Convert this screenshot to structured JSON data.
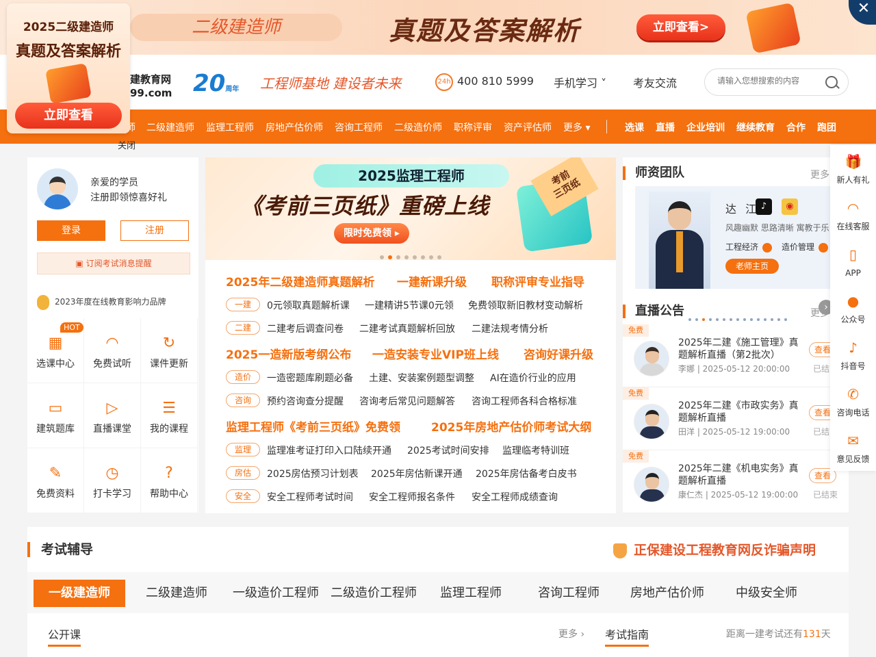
{
  "banner": {
    "pill": "二级建造师",
    "headline": "真题及答案解析",
    "cta": "立即查看>",
    "close": "✕"
  },
  "promo": {
    "line1": "2025二级建造师",
    "line2": "真题及答案解析",
    "button": "立即查看",
    "close": "关闭"
  },
  "header": {
    "logo_line1": "建教育网",
    "logo_line2": "99.com",
    "anniversary": "20",
    "anniversary_sub": "周年",
    "slogan": "工程师基地  建设者未来",
    "phone": "400 810 5999",
    "phone_icon": "24h",
    "nav": [
      "手机学习 ˅",
      "考友交流"
    ],
    "search_placeholder": "请输入您想搜索的内容"
  },
  "orange_nav": {
    "items": [
      "师",
      "二级建造师",
      "监理工程师",
      "房地产估价师",
      "咨询工程师",
      "二级造价师",
      "职称评审",
      "资产评估师",
      "更多 ▾"
    ],
    "bold_items": [
      "选课",
      "直播",
      "企业培训",
      "继续教育",
      "合作",
      "跑团"
    ]
  },
  "left": {
    "greeting1": "亲爱的学员",
    "greeting2": "注册即领惊喜好礼",
    "login": "登录",
    "register": "注册",
    "subscribe": "订阅考试消息提醒",
    "brand": "2023年度在线教育影响力品牌",
    "hot": "HOT",
    "grid": [
      {
        "label": "选课中心",
        "icon": "calendar-icon",
        "glyph": "▦"
      },
      {
        "label": "免费试听",
        "icon": "headphones-icon",
        "glyph": "◠"
      },
      {
        "label": "课件更新",
        "icon": "refresh-icon",
        "glyph": "↻"
      },
      {
        "label": "建筑题库",
        "icon": "monitor-icon",
        "glyph": "▭"
      },
      {
        "label": "直播课堂",
        "icon": "play-icon",
        "glyph": "▷"
      },
      {
        "label": "我的课程",
        "icon": "board-icon",
        "glyph": "☰"
      },
      {
        "label": "免费资料",
        "icon": "document-icon",
        "glyph": "✎"
      },
      {
        "label": "打卡学习",
        "icon": "alarm-icon",
        "glyph": "◷"
      },
      {
        "label": "帮助中心",
        "icon": "help-icon",
        "glyph": "?"
      }
    ]
  },
  "hero": {
    "tag": "2025监理工程师",
    "title": "《考前三页纸》重磅上线",
    "free": "限时免费领 ▸",
    "corner": "考前\n三页纸"
  },
  "news": {
    "h1": [
      "2025年二级建造师真题解析",
      "一建新课升级",
      "职称评审专业指导"
    ],
    "row1": {
      "tag": "一建",
      "links": [
        "0元领取真题解析课",
        "一建精讲5节课0元领",
        "免费领取新旧教材变动解析"
      ]
    },
    "row2": {
      "tag": "二建",
      "links": [
        "二建考后调查问卷",
        "二建考试真题解析回放",
        "二建法规考情分析"
      ]
    },
    "h2": [
      "2025一造新版考纲公布",
      "一造安装专业VIP班上线",
      "咨询好课升级"
    ],
    "row3": {
      "tag": "造价",
      "links": [
        "一造密题库刷题必备",
        "土建、安装案例题型调整",
        "AI在造价行业的应用"
      ]
    },
    "row4": {
      "tag": "咨询",
      "links": [
        "预约咨询查分提醒",
        "咨询考后常见问题解答",
        "咨询工程师各科合格标准"
      ]
    },
    "h3": [
      "监理工程师《考前三页纸》免费领",
      "2025年房地产估价师考试大纲"
    ],
    "row5": {
      "tag": "监理",
      "links": [
        "监理准考证打印入口陆续开通",
        "2025考试时间安排",
        "监理临考特训班"
      ]
    },
    "row6": {
      "tag": "房估",
      "links": [
        "2025房估预习计划表",
        "2025年房估新课开通",
        "2025年房估备考白皮书"
      ]
    },
    "row7": {
      "tag": "安全",
      "links": [
        "安全工程师考试时间",
        "安全工程师报名条件",
        "安全工程师成绩查询"
      ]
    }
  },
  "teachers": {
    "title": "师资团队",
    "more": "更多",
    "name": "达 江",
    "desc": "风趣幽默 思路清晰 寓教于乐",
    "subject1": "工程经济",
    "subject2": "造价管理",
    "home": "老师主页",
    "tiktok": "♪",
    "weibo": "◉"
  },
  "live": {
    "title": "直播公告",
    "more": "更多",
    "items": [
      {
        "tag": "免费",
        "title": "2025年二建《施工管理》真题解析直播（第2批次）",
        "meta": "李娜 | 2025-05-12 20:00:00",
        "btn": "查看",
        "status": "已结束"
      },
      {
        "tag": "免费",
        "title": "2025年二建《市政实务》真题解析直播",
        "meta": "田洋 | 2025-05-12 19:00:00",
        "btn": "查看",
        "status": "已结束"
      },
      {
        "tag": "免费",
        "title": "2025年二建《机电实务》真题解析直播",
        "meta": "康仁杰 | 2025-05-12 19:00:00",
        "btn": "查看",
        "status": "已结束"
      }
    ]
  },
  "tools": [
    {
      "label": "新人有礼",
      "icon": "gift-icon",
      "glyph": "🎁"
    },
    {
      "label": "在线客服",
      "icon": "headset-icon",
      "glyph": "◠"
    },
    {
      "label": "APP",
      "icon": "phone-icon",
      "glyph": "▯"
    },
    {
      "label": "公众号",
      "icon": "wechat-icon",
      "glyph": "●"
    },
    {
      "label": "抖音号",
      "icon": "tiktok-icon",
      "glyph": "♪"
    },
    {
      "label": "咨询电话",
      "icon": "telephone-icon",
      "glyph": "✆"
    },
    {
      "label": "意见反馈",
      "icon": "mail-icon",
      "glyph": "✉"
    }
  ],
  "bottom": {
    "title": "考试辅导",
    "fraud": "正保建设工程教育网反诈骗声明",
    "tabs": [
      "一级建造师",
      "二级建造师",
      "一级造价工程师",
      "二级造价工程师",
      "监理工程师",
      "咨询工程师",
      "房地产估价师",
      "中级安全师"
    ],
    "open_class": "公开课",
    "more": "更多 ›",
    "guide": "考试指南",
    "countdown_prefix": "距离一建考试还有",
    "countdown_days": "131",
    "countdown_suffix": "天"
  }
}
